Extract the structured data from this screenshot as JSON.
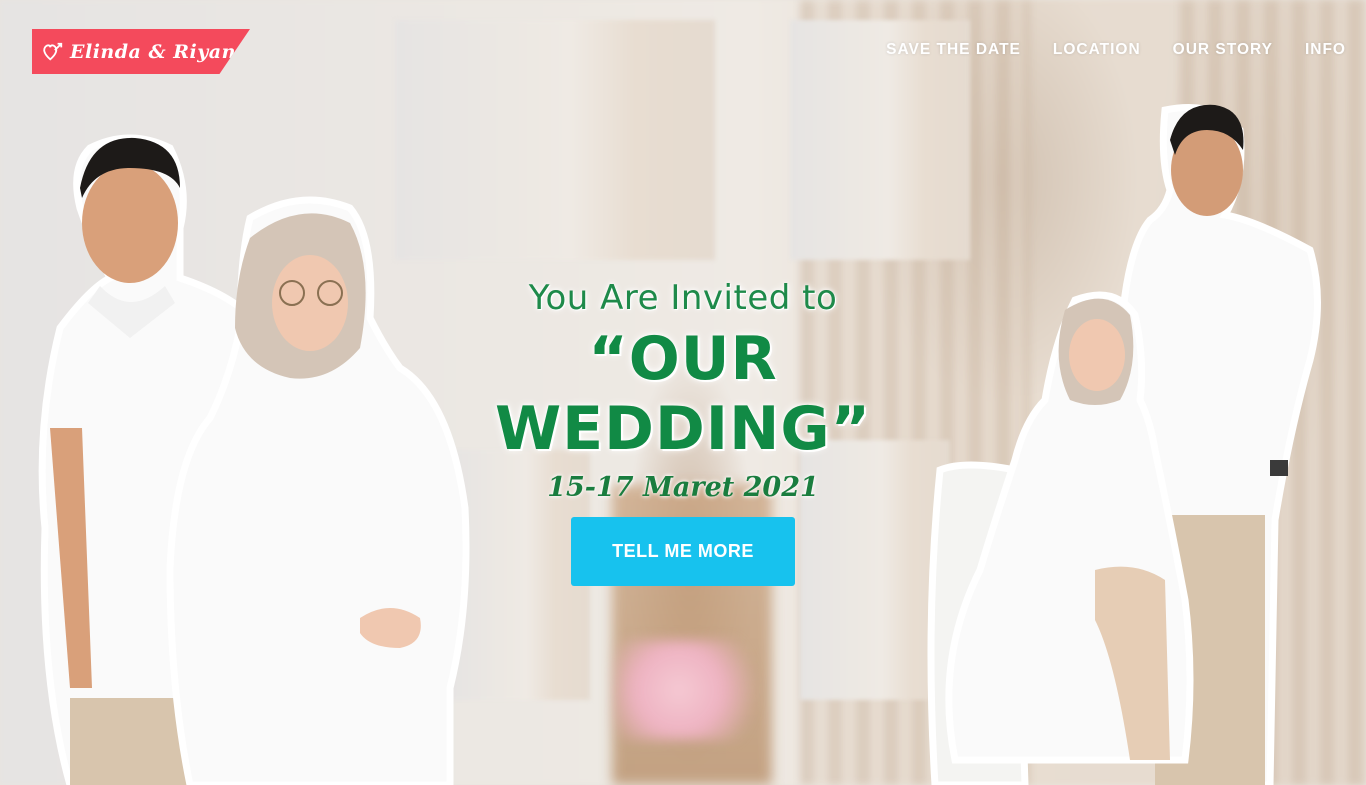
{
  "brand": {
    "name": "Elinda & Riyan",
    "icon": "hearts-icon",
    "color": "#f44a5c"
  },
  "nav": {
    "items": [
      {
        "label": "SAVE THE DATE"
      },
      {
        "label": "LOCATION"
      },
      {
        "label": "OUR STORY"
      },
      {
        "label": "INFO"
      }
    ]
  },
  "hero": {
    "invite_line": "You Are Invited to",
    "headline": "“OUR WEDDING”",
    "date": "15-17 Maret 2021",
    "cta_label": "TELL ME MORE",
    "text_color": "#118a45",
    "cta_color": "#17c2ee"
  }
}
